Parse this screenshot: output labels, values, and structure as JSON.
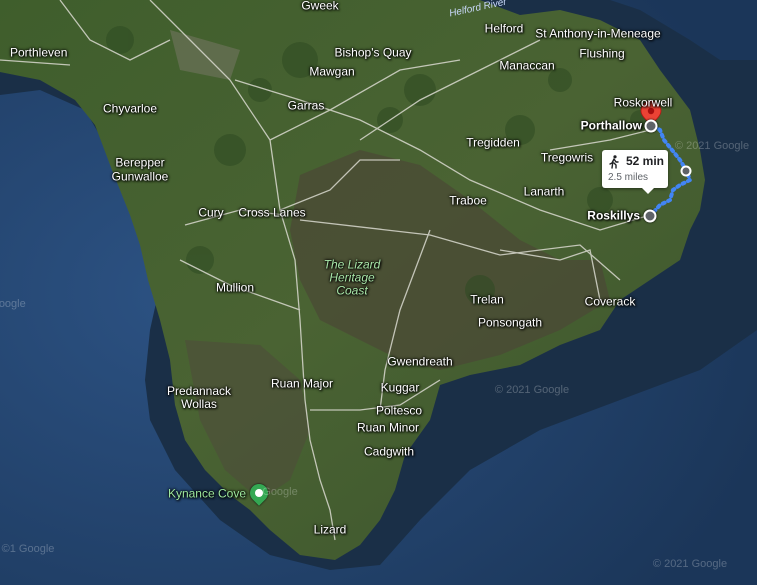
{
  "map": {
    "places": {
      "porthleven": "Porthleven",
      "gweek": "Gweek",
      "helford_river": "Helford River",
      "helford": "Helford",
      "st_anthony": "St Anthony-in-Meneage",
      "flushing": "Flushing",
      "bishops_quay": "Bishop's Quay",
      "mawgan": "Mawgan",
      "manaccan": "Manaccan",
      "roskorwell": "Roskorwell",
      "porthallow": "Porthallow",
      "garras": "Garras",
      "chyvarloe": "Chyvarloe",
      "berepper": "Berepper",
      "gunwalloe": "Gunwalloe",
      "tregidden": "Tregidden",
      "tregowris": "Tregowris",
      "lanarth": "Lanarth",
      "roskillys": "Roskillys",
      "cury": "Cury",
      "cross_lanes": "Cross Lanes",
      "traboe": "Traboe",
      "lizard_heritage": "The Lizard Heritage Coast",
      "mullion": "Mullion",
      "trelan": "Trelan",
      "coverack": "Coverack",
      "ponsongath": "Ponsongath",
      "gwendreath": "Gwendreath",
      "predannack": "Predannack Wollas",
      "ruan_major": "Ruan Major",
      "kuggar": "Kuggar",
      "poltesco": "Poltesco",
      "ruan_minor": "Ruan Minor",
      "cadgwith": "Cadgwith",
      "kynance": "Kynance Cove",
      "lizard": "Lizard"
    },
    "watermarks": [
      "© 2021 Google",
      "© 2021 Google",
      "©1 Google",
      "© 2021 Google",
      "Google",
      "Google"
    ],
    "colors": {
      "route": "#4285f4",
      "destination_pin": "#ea4335",
      "sea": "#22426b",
      "land": "#3d5a2e"
    }
  },
  "route": {
    "mode_icon": "walking-person-icon",
    "duration": "52 min",
    "distance": "2.5 miles",
    "start": "Roskillys",
    "end": "Porthallow"
  }
}
